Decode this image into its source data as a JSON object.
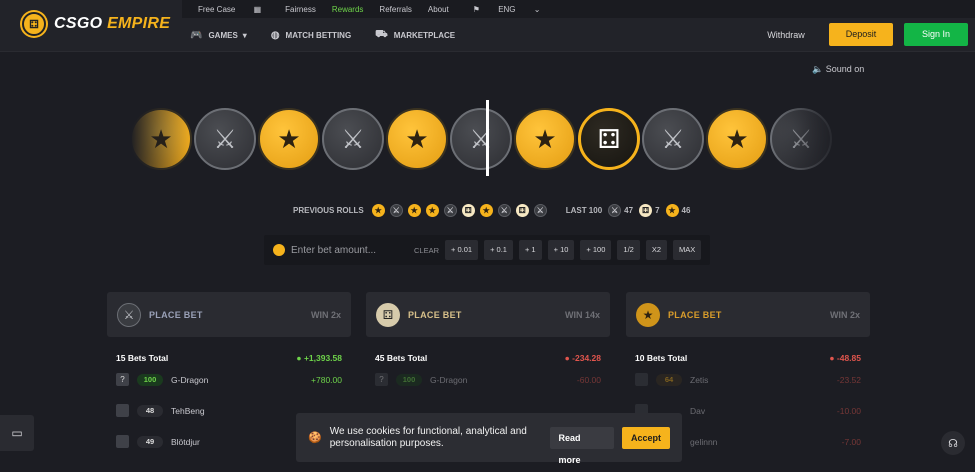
{
  "brand": {
    "name_left": "CSGO",
    "name_right": "EMPIRE",
    "logo_icon": "dice-icon"
  },
  "toplinks": [
    "Free Case",
    "Fairness",
    "Rewards",
    "Referrals",
    "About",
    "ENG"
  ],
  "nav": {
    "games": "GAMES",
    "match_betting": "MATCH BETTING",
    "marketplace": "MARKETPLACE"
  },
  "header_buttons": {
    "withdraw": "Withdraw",
    "deposit": "Deposit",
    "signin": "Sign In"
  },
  "sound": "Sound on",
  "roller": [
    "t",
    "ct",
    "t",
    "ct",
    "t",
    "ct",
    "t",
    "bonus",
    "ct",
    "t",
    "ct"
  ],
  "previous_rolls": {
    "label": "PREVIOUS ROLLS",
    "items": [
      "t",
      "ct",
      "t",
      "t",
      "ct",
      "bonus",
      "t",
      "ct",
      "bonus",
      "ct"
    ],
    "last100_label": "LAST 100",
    "last100": {
      "ct": "47",
      "bonus": "7",
      "t": "46"
    }
  },
  "bet_input": {
    "placeholder": "Enter bet amount...",
    "clear": "CLEAR",
    "buttons": [
      "+ 0.01",
      "+ 0.1",
      "+ 1",
      "+ 10",
      "+ 100",
      "1/2",
      "X2",
      "MAX"
    ]
  },
  "panels": [
    {
      "label": "PLACE BET",
      "win": "WIN 2x",
      "color": "#9aa1b8",
      "icon": "ct",
      "bets_total": "15 Bets Total",
      "total_amount": "+1,393.58",
      "rows": [
        {
          "avatar": "?",
          "level": "100",
          "name": "G-Dragon",
          "value": "+780.00"
        },
        {
          "avatar": "",
          "level": "48",
          "name": "TehBeng",
          "value": ""
        },
        {
          "avatar": "",
          "level": "49",
          "name": "Blötdjur",
          "value": ""
        }
      ]
    },
    {
      "label": "PLACE BET",
      "win": "WIN 14x",
      "color": "#d7c08a",
      "icon": "bonus",
      "bets_total": "45 Bets Total",
      "total_amount": "-234.28",
      "rows": [
        {
          "avatar": "?",
          "level": "100",
          "name": "G-Dragon",
          "value": "-60.00"
        }
      ]
    },
    {
      "label": "PLACE BET",
      "win": "WIN 2x",
      "color": "#d99d2b",
      "icon": "t",
      "bets_total": "10 Bets Total",
      "total_amount": "-48.85",
      "rows": [
        {
          "avatar": "",
          "level": "64",
          "name": "Zetis",
          "value": "-23.52"
        },
        {
          "avatar": "",
          "level": "",
          "name": "Dav",
          "value": "-10.00"
        },
        {
          "avatar": "",
          "level": "",
          "name": "gelinnn",
          "value": "-7.00"
        }
      ]
    }
  ],
  "cookie": {
    "text": "We use cookies for functional, analytical and personalisation purposes.",
    "read_more": "Read more",
    "accept": "Accept"
  }
}
